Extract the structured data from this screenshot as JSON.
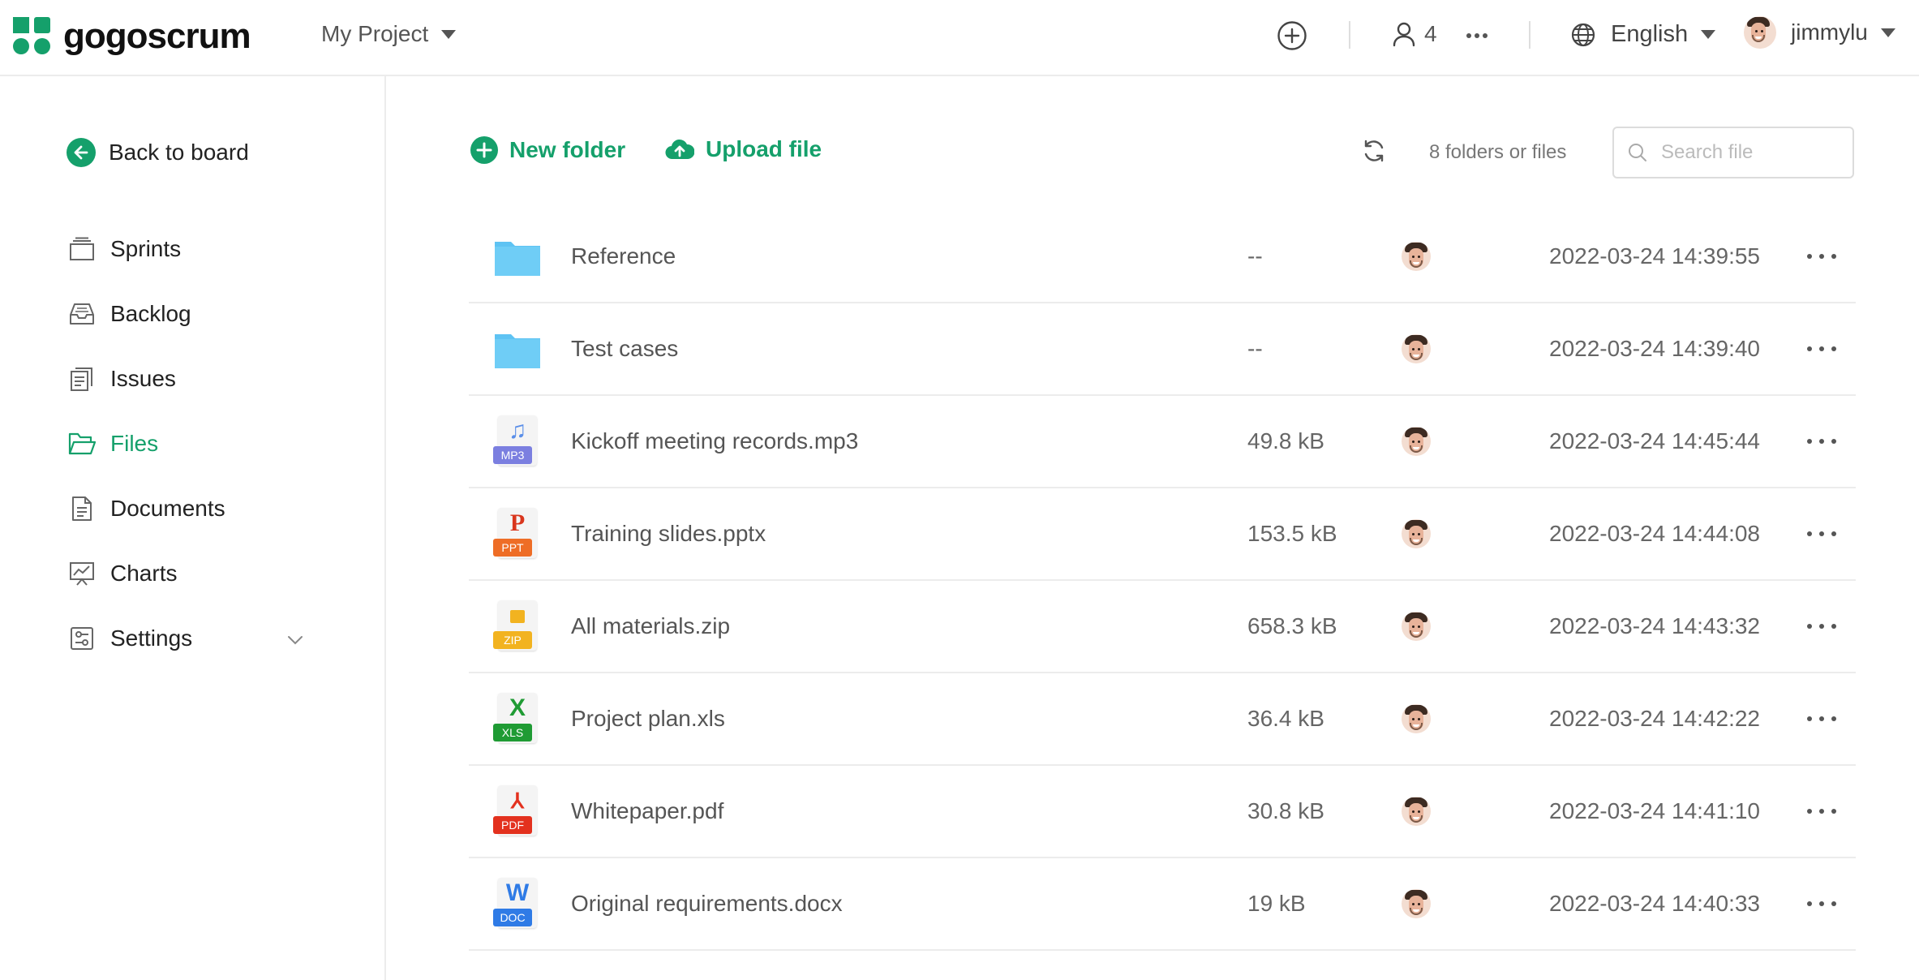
{
  "header": {
    "brand": "gogoscrum",
    "project_name": "My Project",
    "member_count": "4",
    "language": "English",
    "username": "jimmylu"
  },
  "sidebar": {
    "back_label": "Back to board",
    "items": [
      {
        "label": "Sprints",
        "icon": "sprints-icon"
      },
      {
        "label": "Backlog",
        "icon": "inbox-icon"
      },
      {
        "label": "Issues",
        "icon": "issues-icon"
      },
      {
        "label": "Files",
        "icon": "folder-open-icon",
        "active": true
      },
      {
        "label": "Documents",
        "icon": "document-icon"
      },
      {
        "label": "Charts",
        "icon": "chart-icon"
      },
      {
        "label": "Settings",
        "icon": "settings-icon"
      }
    ]
  },
  "toolbar": {
    "new_folder_label": "New folder",
    "upload_file_label": "Upload file",
    "count_text": "8 folders or files",
    "search_placeholder": "Search file"
  },
  "files": [
    {
      "name": "Reference",
      "type": "folder",
      "size": "--",
      "date": "2022-03-24 14:39:55"
    },
    {
      "name": "Test cases",
      "type": "folder",
      "size": "--",
      "date": "2022-03-24 14:39:40"
    },
    {
      "name": "Kickoff meeting records.mp3",
      "type": "MP3",
      "size": "49.8 kB",
      "date": "2022-03-24 14:45:44"
    },
    {
      "name": "Training slides.pptx",
      "type": "PPT",
      "size": "153.5 kB",
      "date": "2022-03-24 14:44:08"
    },
    {
      "name": "All materials.zip",
      "type": "ZIP",
      "size": "658.3 kB",
      "date": "2022-03-24 14:43:32"
    },
    {
      "name": "Project plan.xls",
      "type": "XLS",
      "size": "36.4 kB",
      "date": "2022-03-24 14:42:22"
    },
    {
      "name": "Whitepaper.pdf",
      "type": "PDF",
      "size": "30.8 kB",
      "date": "2022-03-24 14:41:10"
    },
    {
      "name": "Original requirements.docx",
      "type": "DOC",
      "size": "19 kB",
      "date": "2022-03-24 14:40:33"
    }
  ],
  "colors": {
    "accent": "#15a06b",
    "folder": "#5ec3f3",
    "mp3": "#7b7fe0",
    "ppt": "#ee6d26",
    "zip": "#f2b320",
    "xls": "#1f9b34",
    "pdf": "#e3311e",
    "doc": "#2f7be6"
  }
}
